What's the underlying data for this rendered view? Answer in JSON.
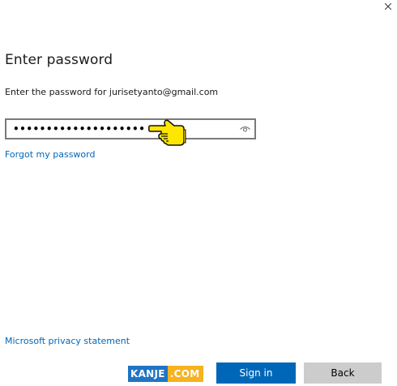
{
  "dialog": {
    "title": "Enter password",
    "subtitle": "Enter the password for jurisetyanto@gmail.com",
    "password_value": "••••••••••••••••••••",
    "forgot_link": "Forgot my password",
    "privacy_link": "Microsoft privacy statement",
    "signin_label": "Sign in",
    "back_label": "Back"
  },
  "watermark": {
    "part1": "KANJE",
    "part2": ".COM"
  },
  "icons": {
    "close": "close-icon",
    "reveal": "eye-icon",
    "pointer": "pointing-hand-icon"
  },
  "colors": {
    "link": "#0067b8",
    "primary_button": "#0067b8",
    "secondary_button": "#cccccc",
    "input_border": "#7a7a7a",
    "watermark_blue": "#1f74c6",
    "watermark_orange": "#f6b21f",
    "hand_yellow": "#ffe600"
  }
}
